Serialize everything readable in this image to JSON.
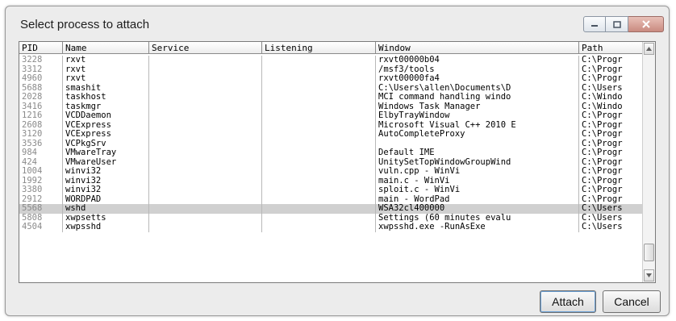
{
  "window": {
    "title": "Select process to attach"
  },
  "columns": {
    "pid": "PID",
    "name": "Name",
    "service": "Service",
    "listening": "Listening",
    "window": "Window",
    "path": "Path"
  },
  "processes": [
    {
      "pid": "3228",
      "name": "rxvt",
      "service": "",
      "listening": "",
      "window": "rxvt00000b04",
      "path": "C:\\Progr"
    },
    {
      "pid": "3312",
      "name": "rxvt",
      "service": "",
      "listening": "",
      "window": "/msf3/tools",
      "path": "C:\\Progr"
    },
    {
      "pid": "4960",
      "name": "rxvt",
      "service": "",
      "listening": "",
      "window": "rxvt00000fa4",
      "path": "C:\\Progr"
    },
    {
      "pid": "5688",
      "name": "smashit",
      "service": "",
      "listening": "",
      "window": "C:\\Users\\allen\\Documents\\D",
      "path": "C:\\Users"
    },
    {
      "pid": "2028",
      "name": "taskhost",
      "service": "",
      "listening": "",
      "window": "MCI command handling windo",
      "path": "C:\\Windo"
    },
    {
      "pid": "3416",
      "name": "taskmgr",
      "service": "",
      "listening": "",
      "window": "Windows Task Manager",
      "path": "C:\\Windo"
    },
    {
      "pid": "1216",
      "name": "VCDDaemon",
      "service": "",
      "listening": "",
      "window": "ElbyTrayWindow",
      "path": "C:\\Progr"
    },
    {
      "pid": "2608",
      "name": "VCExpress",
      "service": "",
      "listening": "",
      "window": "Microsoft Visual C++ 2010 E",
      "path": "C:\\Progr"
    },
    {
      "pid": "3120",
      "name": "VCExpress",
      "service": "",
      "listening": "",
      "window": "AutoCompleteProxy",
      "path": "C:\\Progr"
    },
    {
      "pid": "3536",
      "name": "VCPkgSrv",
      "service": "",
      "listening": "",
      "window": "",
      "path": "C:\\Progr"
    },
    {
      "pid": "984",
      "name": "VMwareTray",
      "service": "",
      "listening": "",
      "window": "Default IME",
      "path": "C:\\Progr"
    },
    {
      "pid": "424",
      "name": "VMwareUser",
      "service": "",
      "listening": "",
      "window": "UnitySetTopWindowGroupWind",
      "path": "C:\\Progr"
    },
    {
      "pid": "1004",
      "name": "winvi32",
      "service": "",
      "listening": "",
      "window": "vuln.cpp - WinVi",
      "path": "C:\\Progr"
    },
    {
      "pid": "1992",
      "name": "winvi32",
      "service": "",
      "listening": "",
      "window": "main.c - WinVi",
      "path": "C:\\Progr"
    },
    {
      "pid": "3380",
      "name": "winvi32",
      "service": "",
      "listening": "",
      "window": "sploit.c - WinVi",
      "path": "C:\\Progr"
    },
    {
      "pid": "2912",
      "name": "WORDPAD",
      "service": "",
      "listening": "",
      "window": "main - WordPad",
      "path": "C:\\Progr"
    },
    {
      "pid": "5568",
      "name": "wshd",
      "service": "",
      "listening": "",
      "window": "WSA32cl400000",
      "path": "C:\\Users"
    },
    {
      "pid": "5808",
      "name": "xwpsetts",
      "service": "",
      "listening": "",
      "window": "Settings (60 minutes evalu",
      "path": "C:\\Users"
    },
    {
      "pid": "4504",
      "name": "xwpsshd",
      "service": "",
      "listening": "",
      "window": "xwpsshd.exe -RunAsExe",
      "path": "C:\\Users"
    }
  ],
  "selected_row": 16,
  "buttons": {
    "attach": "Attach",
    "cancel": "Cancel"
  },
  "colors": {
    "selection": "#d0d0d0",
    "pid_text": "#8a8a8a",
    "dialog_bg": "#ececec"
  }
}
